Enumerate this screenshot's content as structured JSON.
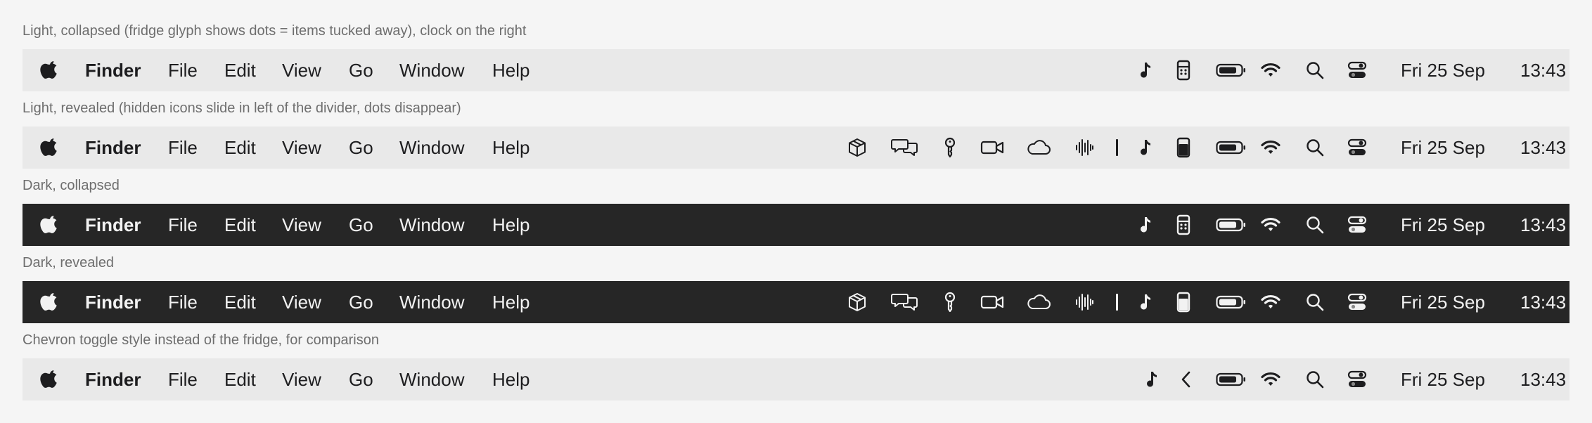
{
  "captions": {
    "c1": "Light, collapsed (fridge glyph shows dots = items tucked away), clock on the right",
    "c2": "Light, revealed (hidden icons slide in left of the divider, dots disappear)",
    "c3": "Dark, collapsed",
    "c4": "Dark, revealed",
    "c5": "Chevron toggle style instead of the fridge, for comparison"
  },
  "menu": {
    "app": "Finder",
    "file": "File",
    "edit": "Edit",
    "view": "View",
    "go": "Go",
    "window": "Window",
    "help": "Help"
  },
  "clock": {
    "date": "Fri 25 Sep",
    "time": "13:43"
  },
  "theme": {
    "light_bar": "#e9e9e9",
    "dark_bar": "#262626",
    "page_bg": "#f5f5f5"
  },
  "icons": {
    "hidden_items": [
      "package-icon",
      "chat-bubbles-icon",
      "key-icon",
      "video-camera-icon",
      "cloud-icon",
      "waveform-icon"
    ],
    "status_items": [
      "music-note-icon",
      "fridge-icon",
      "battery-icon",
      "wifi-icon",
      "search-icon",
      "control-center-icon"
    ],
    "chevron_variant": [
      "music-note-icon",
      "chevron-left-icon",
      "battery-icon",
      "wifi-icon",
      "search-icon",
      "control-center-icon"
    ]
  }
}
